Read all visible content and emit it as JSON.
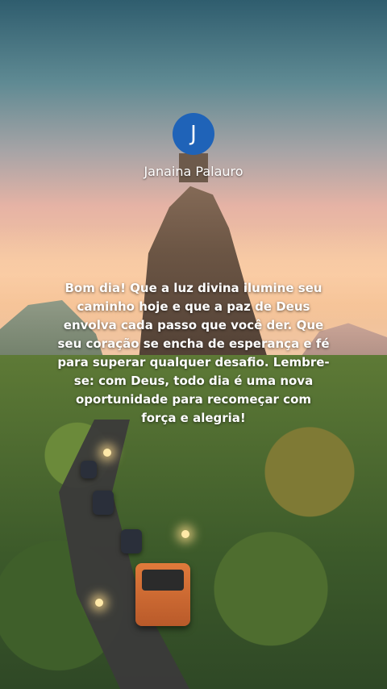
{
  "post": {
    "avatar_initial": "J",
    "avatar_color": "#1f63b8",
    "author_name": "Janaina Palauro",
    "message": "Bom dia! Que a luz divina ilumine seu caminho hoje e que a paz de Deus envolva cada passo que você der. Que seu coração se encha de esperança e fé para superar qualquer desafio. Lembre-se: com Deus, todo dia é uma nova oportunidade para recomeçar com força e alegria!"
  },
  "background": {
    "scene": "sunset-mountain-road-image"
  }
}
